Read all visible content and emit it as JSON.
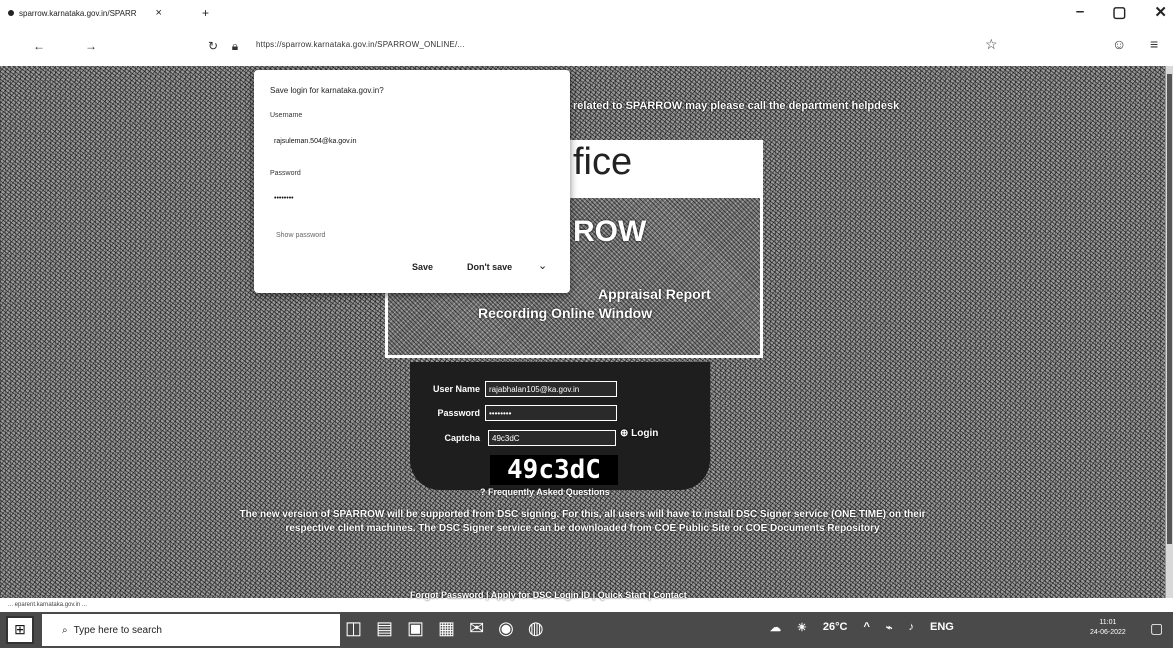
{
  "browser": {
    "tab_title": "sparrow.karnataka.gov.in/SPARR",
    "tab_close": "×",
    "new_tab": "+",
    "url": "https://sparrow.karnataka.gov.in/SPARROW_ONLINE/...",
    "win_min": "–",
    "win_max": "▢",
    "win_close": "✕"
  },
  "save_login_popup": {
    "title": "Save login for karnataka.gov.in?",
    "username_label": "Username",
    "username_value": "rajsuleman.504@ka.gov.in",
    "password_label": "Password",
    "password_value": "••••••••",
    "show_password": "Show password",
    "save_label": "Save",
    "dont_save_label": "Don't save",
    "dropdown_icon": "chevron-down-icon"
  },
  "page": {
    "notice_top": "related to SPARROW may please call the department helpdesk",
    "banner_fice": "fice",
    "banner_sub": "...",
    "sparrow_title": "ROW",
    "appraisal_line": "Appraisal Report",
    "recording_line": "Recording Online Window",
    "user_name_label": "User Name",
    "user_name_value": "rajabhalan105@ka.gov.in",
    "password_label": "Password",
    "password_value": "••••••••",
    "captcha_label": "Captcha",
    "captcha_value": "49c3dC",
    "captcha_image_text": "49c3dC",
    "login_label": "Login",
    "faq_label": "Frequently Asked Questions",
    "notice_bottom_1": "The new version of SPARROW will be supported from DSC signing. For this, all users will have to install DSC Signer service (ONE TIME) on their",
    "notice_bottom_2": "respective client machines. The DSC Signer service can be downloaded from COE Public Site or COE Documents Repository",
    "footer_links": "Forgot Password | Apply for DSC Login ID | Quick Start | Contact"
  },
  "status_hint": "... eparent.karnataka.gov.in ...",
  "taskbar": {
    "search_placeholder": "Type here to search",
    "temperature": "26°C",
    "language": "ENG",
    "time": "11:01",
    "date": "24-06-2022"
  }
}
